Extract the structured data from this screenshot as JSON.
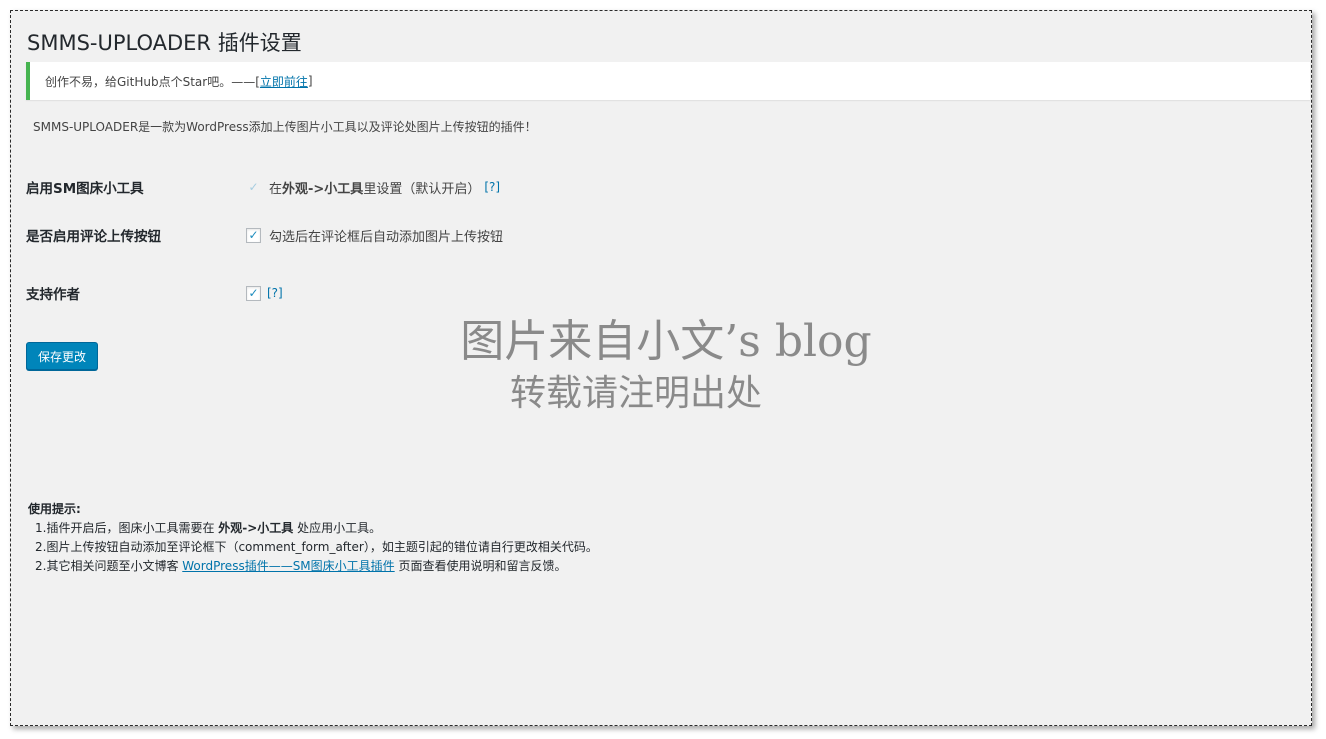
{
  "page": {
    "title": "SMMS-UPLOADER 插件设置"
  },
  "notice": {
    "text": "创作不易，给GitHub点个Star吧。——[",
    "link_label": "立即前往",
    "text_end": "]"
  },
  "description": "SMMS-UPLOADER是一款为WordPress添加上传图片小工具以及评论处图片上传按钮的插件！",
  "settings": [
    {
      "label": "启用SM图床小工具",
      "checked": true,
      "disabled": true,
      "text_before": "在 ",
      "text_bold": "外观->小工具",
      "text_after": " 里设置（默认开启）",
      "help": "[?]"
    },
    {
      "label": "是否启用评论上传按钮",
      "checked": true,
      "disabled": false,
      "text": "勾选后在评论框后自动添加图片上传按钮"
    },
    {
      "label": "支持作者",
      "checked": true,
      "disabled": false,
      "help": "[?]"
    }
  ],
  "save_button": "保存更改",
  "watermark": {
    "line1": "图片来自小文’s blog",
    "line2": "转载请注明出处"
  },
  "tips": {
    "title": "使用提示:",
    "item1_before": "1.插件开启后，图床小工具需要在 ",
    "item1_bold": "外观->小工具",
    "item1_after": " 处应用小工具。",
    "item2": "2.图片上传按钮自动添加至评论框下（comment_form_after），如主题引起的错位请自行更改相关代码。",
    "item3_before": "2.其它相关问题至小文博客 ",
    "item3_link": "WordPress插件——SM图床小工具插件",
    "item3_after": " 页面查看使用说明和留言反馈。"
  },
  "colors": {
    "background": "#f1f1f1",
    "notice_border": "#46b450",
    "link": "#0073aa",
    "primary_button": "#0085ba",
    "checkmark": "#1e8cbe"
  }
}
